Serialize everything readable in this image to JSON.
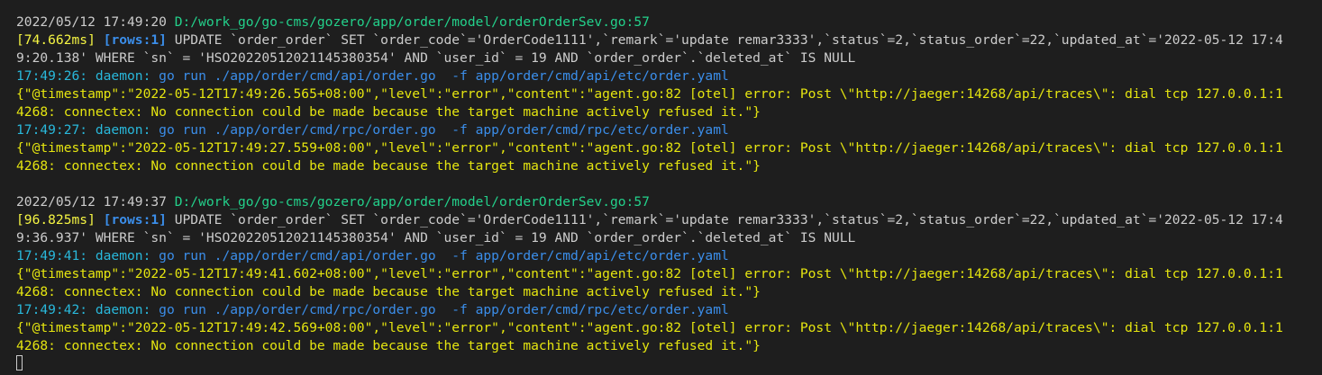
{
  "terminal": {
    "lines": [
      {
        "type": "sql-header",
        "segments": [
          {
            "text": "2022/05/12 17:49:20 ",
            "color": "white"
          },
          {
            "text": "D:/work_go/go-cms/gozero/app/order/model/orderOrderSev.go:57",
            "color": "green"
          }
        ]
      },
      {
        "type": "sql-query",
        "segments": [
          {
            "text": "[74.662ms] ",
            "color": "yellow"
          },
          {
            "text": "[rows:1]",
            "color": "bblue"
          },
          {
            "text": " UPDATE `order_order` SET `order_code`='OrderCode1111',`remark`='update remar3333',`status`=2,`status_order`=22,`updated_at`='2022-05-12 17:4",
            "color": "white"
          }
        ]
      },
      {
        "type": "sql-query",
        "segments": [
          {
            "text": "9:20.138' WHERE `sn` = 'HSO20220512021145380354' AND `user_id` = 19 AND `order_order`.`deleted_at` IS NULL",
            "color": "white"
          }
        ]
      },
      {
        "type": "daemon",
        "segments": [
          {
            "text": "17:49:26: daemon: ",
            "color": "cyan"
          },
          {
            "text": "go run ./app/order/cmd/api/order.go  -f app/order/cmd/api/etc/order.yaml",
            "color": "blue"
          }
        ]
      },
      {
        "type": "log-error",
        "segments": [
          {
            "text": "{\"@timestamp\":\"2022-05-12T17:49:26.565+08:00\",\"level\":\"error\",\"content\":\"agent.go:82 [otel] error: Post \\\"http://jaeger:14268/api/traces\\\": dial tcp 127.0.0.1:1",
            "color": "gold"
          }
        ]
      },
      {
        "type": "log-error",
        "segments": [
          {
            "text": "4268: connectex: No connection could be made because the target machine actively refused it.\"}",
            "color": "gold"
          }
        ]
      },
      {
        "type": "daemon",
        "segments": [
          {
            "text": "17:49:27: daemon: ",
            "color": "cyan"
          },
          {
            "text": "go run ./app/order/cmd/rpc/order.go  -f app/order/cmd/rpc/etc/order.yaml",
            "color": "blue"
          }
        ]
      },
      {
        "type": "log-error",
        "segments": [
          {
            "text": "{\"@timestamp\":\"2022-05-12T17:49:27.559+08:00\",\"level\":\"error\",\"content\":\"agent.go:82 [otel] error: Post \\\"http://jaeger:14268/api/traces\\\": dial tcp 127.0.0.1:1",
            "color": "gold"
          }
        ]
      },
      {
        "type": "log-error",
        "segments": [
          {
            "text": "4268: connectex: No connection could be made because the target machine actively refused it.\"}",
            "color": "gold"
          }
        ]
      },
      {
        "type": "blank",
        "segments": [
          {
            "text": "",
            "color": "white"
          }
        ]
      },
      {
        "type": "sql-header",
        "segments": [
          {
            "text": "2022/05/12 17:49:37 ",
            "color": "white"
          },
          {
            "text": "D:/work_go/go-cms/gozero/app/order/model/orderOrderSev.go:57",
            "color": "green"
          }
        ]
      },
      {
        "type": "sql-query",
        "segments": [
          {
            "text": "[96.825ms] ",
            "color": "yellow"
          },
          {
            "text": "[rows:1]",
            "color": "bblue"
          },
          {
            "text": " UPDATE `order_order` SET `order_code`='OrderCode1111',`remark`='update remar3333',`status`=2,`status_order`=22,`updated_at`='2022-05-12 17:4",
            "color": "white"
          }
        ]
      },
      {
        "type": "sql-query",
        "segments": [
          {
            "text": "9:36.937' WHERE `sn` = 'HSO20220512021145380354' AND `user_id` = 19 AND `order_order`.`deleted_at` IS NULL",
            "color": "white"
          }
        ]
      },
      {
        "type": "daemon",
        "segments": [
          {
            "text": "17:49:41: daemon: ",
            "color": "cyan"
          },
          {
            "text": "go run ./app/order/cmd/api/order.go  -f app/order/cmd/api/etc/order.yaml",
            "color": "blue"
          }
        ]
      },
      {
        "type": "log-error",
        "segments": [
          {
            "text": "{\"@timestamp\":\"2022-05-12T17:49:41.602+08:00\",\"level\":\"error\",\"content\":\"agent.go:82 [otel] error: Post \\\"http://jaeger:14268/api/traces\\\": dial tcp 127.0.0.1:1",
            "color": "gold"
          }
        ]
      },
      {
        "type": "log-error",
        "segments": [
          {
            "text": "4268: connectex: No connection could be made because the target machine actively refused it.\"}",
            "color": "gold"
          }
        ]
      },
      {
        "type": "daemon",
        "segments": [
          {
            "text": "17:49:42: daemon: ",
            "color": "cyan"
          },
          {
            "text": "go run ./app/order/cmd/rpc/order.go  -f app/order/cmd/rpc/etc/order.yaml",
            "color": "blue"
          }
        ]
      },
      {
        "type": "log-error",
        "segments": [
          {
            "text": "{\"@timestamp\":\"2022-05-12T17:49:42.569+08:00\",\"level\":\"error\",\"content\":\"agent.go:82 [otel] error: Post \\\"http://jaeger:14268/api/traces\\\": dial tcp 127.0.0.1:1",
            "color": "gold"
          }
        ]
      },
      {
        "type": "log-error",
        "segments": [
          {
            "text": "4268: connectex: No connection could be made because the target machine actively refused it.\"}",
            "color": "gold"
          }
        ]
      }
    ],
    "colors": {
      "background": "#1e1e1e",
      "white": "#cccccc",
      "green": "#23d18b",
      "yellow": "#f5f543",
      "gold": "#e5e510",
      "blue": "#3b8eea",
      "cyan": "#29b8db"
    }
  }
}
